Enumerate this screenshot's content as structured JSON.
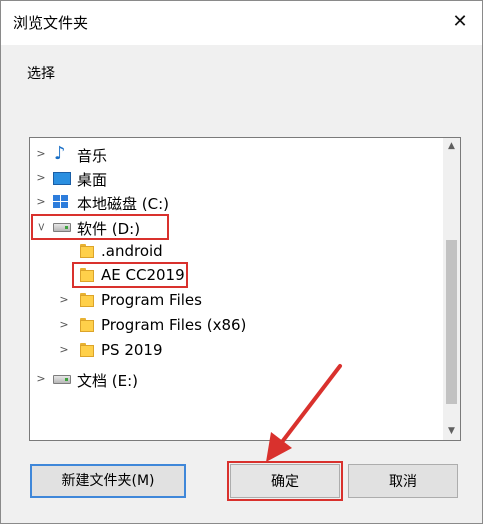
{
  "dialog": {
    "title": "浏览文件夹",
    "prompt": "选择"
  },
  "tree": {
    "items": [
      {
        "label": "音乐",
        "icon": "music-icon",
        "expanded": false
      },
      {
        "label": "桌面",
        "icon": "desktop-icon",
        "expanded": false
      },
      {
        "label": "本地磁盘 (C:)",
        "icon": "windows-drive-icon",
        "expanded": false
      },
      {
        "label": "软件 (D:)",
        "icon": "drive-icon",
        "expanded": true
      },
      {
        "label": ".android",
        "icon": "folder-icon"
      },
      {
        "label": "AE CC2019",
        "icon": "folder-icon",
        "selected": true
      },
      {
        "label": "Program Files",
        "icon": "folder-icon",
        "expanded": false
      },
      {
        "label": "Program Files (x86)",
        "icon": "folder-icon",
        "expanded": false
      },
      {
        "label": "PS 2019",
        "icon": "folder-icon",
        "expanded": false
      },
      {
        "label": "文档 (E:)",
        "icon": "drive-icon",
        "expanded": false
      }
    ]
  },
  "buttons": {
    "new_folder": "新建文件夹(M)",
    "ok": "确定",
    "cancel": "取消"
  },
  "colors": {
    "annotation_red": "#d9312d",
    "focus_blue": "#3f87d9"
  }
}
